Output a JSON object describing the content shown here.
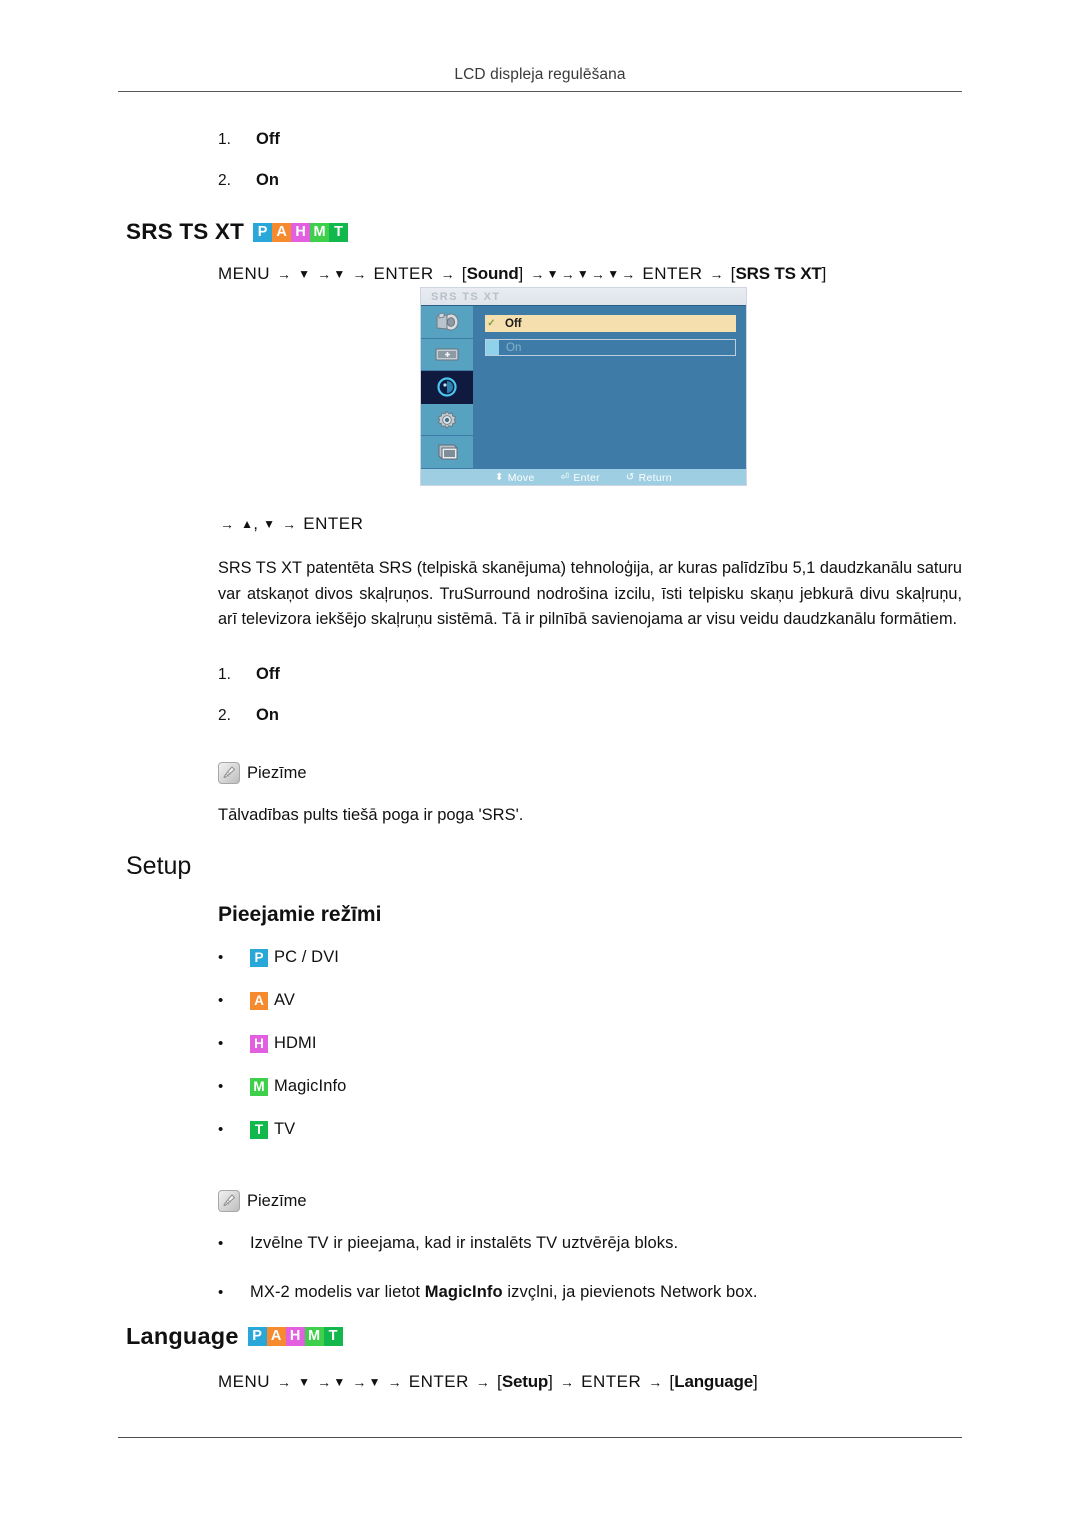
{
  "page": {
    "running_head": "LCD displeja regulēšana"
  },
  "top_list": {
    "items": [
      {
        "num": "1.",
        "label": "Off"
      },
      {
        "num": "2.",
        "label": "On"
      }
    ]
  },
  "srs_section": {
    "title": "SRS TS XT",
    "badges": [
      {
        "letter": "P",
        "color": "#29a7d8"
      },
      {
        "letter": "A",
        "color": "#f58a2e"
      },
      {
        "letter": "H",
        "color": "#e25fe0"
      },
      {
        "letter": "M",
        "color": "#3ed04b"
      },
      {
        "letter": "T",
        "color": "#12b84c"
      }
    ],
    "menu_path": {
      "menu": "MENU",
      "enter": "ENTER",
      "down": "▼",
      "up": "▲",
      "arrow": "→",
      "token_sound": "Sound",
      "token_srs": "SRS TS XT",
      "bracket_open": "[",
      "bracket_close": "]"
    },
    "enter_line": {
      "arrow": "→",
      "up": "▲",
      "comma": ",",
      "down": "▼",
      "enter": "ENTER"
    },
    "paragraph": "SRS TS XT patentēta SRS (telpiskā skanējuma) tehnoloģija, ar kuras palīdzību 5,1 daudzkanālu saturu var atskaņot divos skaļruņos. TruSurround nodrošina izcilu, īsti telpisku skaņu jebkurā divu skaļruņu, arī televizora iekšējo skaļruņu sistēmā. Tā ir pilnībā savienojama ar visu veidu daudzkanālu formātiem.",
    "options": [
      {
        "num": "1.",
        "label": "Off"
      },
      {
        "num": "2.",
        "label": "On"
      }
    ],
    "note_label": "Piezīme",
    "note_text": "Tālvadības pults tiešā poga ir poga 'SRS'."
  },
  "osd": {
    "title": "SRS TS XT",
    "sidebar_icons": [
      "picture-icon",
      "image-icon",
      "sound-icon",
      "setup-icon",
      "multi-control-icon"
    ],
    "selected_sidebar_index": 2,
    "rows": [
      {
        "label": "Off",
        "selected": true,
        "check": "✓"
      },
      {
        "label": "On",
        "selected": false,
        "check": ""
      }
    ],
    "footer": [
      {
        "glyph": "⬍",
        "label": "Move"
      },
      {
        "glyph": "⏎",
        "label": "Enter"
      },
      {
        "glyph": "↺",
        "label": "Return"
      }
    ],
    "colors": {
      "background": "#3e7ba6",
      "sidebar": "#57a2c0",
      "selected_row": "#f6dfae",
      "footer": "#9ecee2",
      "active_cell": "#101a3e"
    }
  },
  "setup_section": {
    "title": "Setup",
    "subtitle": "Pieejamie režīmi",
    "modes": [
      {
        "badge": "P",
        "color": "#29a7d8",
        "label": "PC / DVI"
      },
      {
        "badge": "A",
        "color": "#f58a2e",
        "label": "AV"
      },
      {
        "badge": "H",
        "color": "#e25fe0",
        "label": "HDMI"
      },
      {
        "badge": "M",
        "color": "#3ed04b",
        "label": "MagicInfo"
      },
      {
        "badge": "T",
        "color": "#12b84c",
        "label": "TV"
      }
    ],
    "note_label": "Piezīme",
    "notes": [
      "Izvēlne TV ir pieejama, kad ir instalēts TV uztvērēja bloks.",
      "MX-2 modelis var lietot MagicInfo izvçlni, ja pievienots Network box."
    ],
    "note2_pre": "MX-2 modelis var lietot ",
    "note2_bold": "MagicInfo",
    "note2_post": " izvçlni, ja pievienots Network box."
  },
  "language_section": {
    "title": "Language",
    "badges": [
      {
        "letter": "P",
        "color": "#29a7d8"
      },
      {
        "letter": "A",
        "color": "#f58a2e"
      },
      {
        "letter": "H",
        "color": "#e25fe0"
      },
      {
        "letter": "M",
        "color": "#3ed04b"
      },
      {
        "letter": "T",
        "color": "#12b84c"
      }
    ],
    "menu_path": {
      "menu": "MENU",
      "enter": "ENTER",
      "down": "▼",
      "arrow": "→",
      "token_setup": "Setup",
      "token_language": "Language",
      "bracket_open": "[",
      "bracket_close": "]"
    }
  }
}
